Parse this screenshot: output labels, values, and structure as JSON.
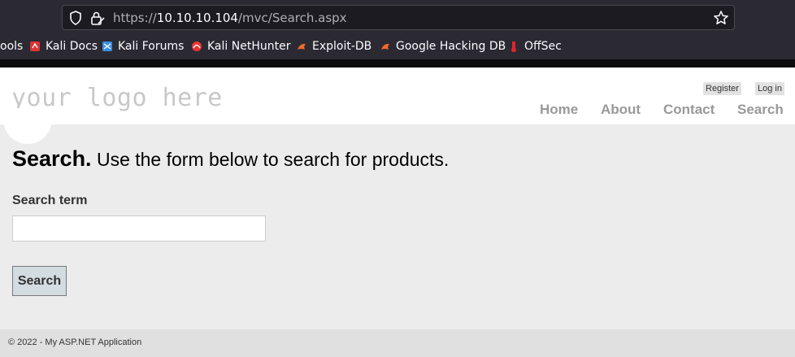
{
  "browser": {
    "url_scheme": "https://",
    "url_host": "10.10.10.104",
    "url_path": "/mvc/Search.aspx",
    "bookmarks": [
      {
        "label": "ools",
        "icon": "tools-icon"
      },
      {
        "label": "Kali Docs",
        "icon": "kali-docs-icon"
      },
      {
        "label": "Kali Forums",
        "icon": "kali-forums-icon"
      },
      {
        "label": "Kali NetHunter",
        "icon": "kali-nethunter-icon"
      },
      {
        "label": "Exploit-DB",
        "icon": "exploit-db-icon"
      },
      {
        "label": "Google Hacking DB",
        "icon": "ghdb-icon"
      },
      {
        "label": "OffSec",
        "icon": "offsec-icon"
      }
    ]
  },
  "header": {
    "logo_text": "your logo here",
    "register_label": "Register",
    "login_label": "Log in",
    "nav": [
      "Home",
      "About",
      "Contact",
      "Search"
    ]
  },
  "main": {
    "title_strong": "Search.",
    "title_rest": " Use the form below to search for products.",
    "field_label": "Search term",
    "field_value": "",
    "button_label": "Search"
  },
  "footer": {
    "text": "© 2022 - My ASP.NET Application"
  },
  "colors": {
    "chrome_bg": "#2b2a33",
    "page_bg": "#ececec",
    "nav_color": "#999999",
    "button_bg": "#d3dce0"
  }
}
